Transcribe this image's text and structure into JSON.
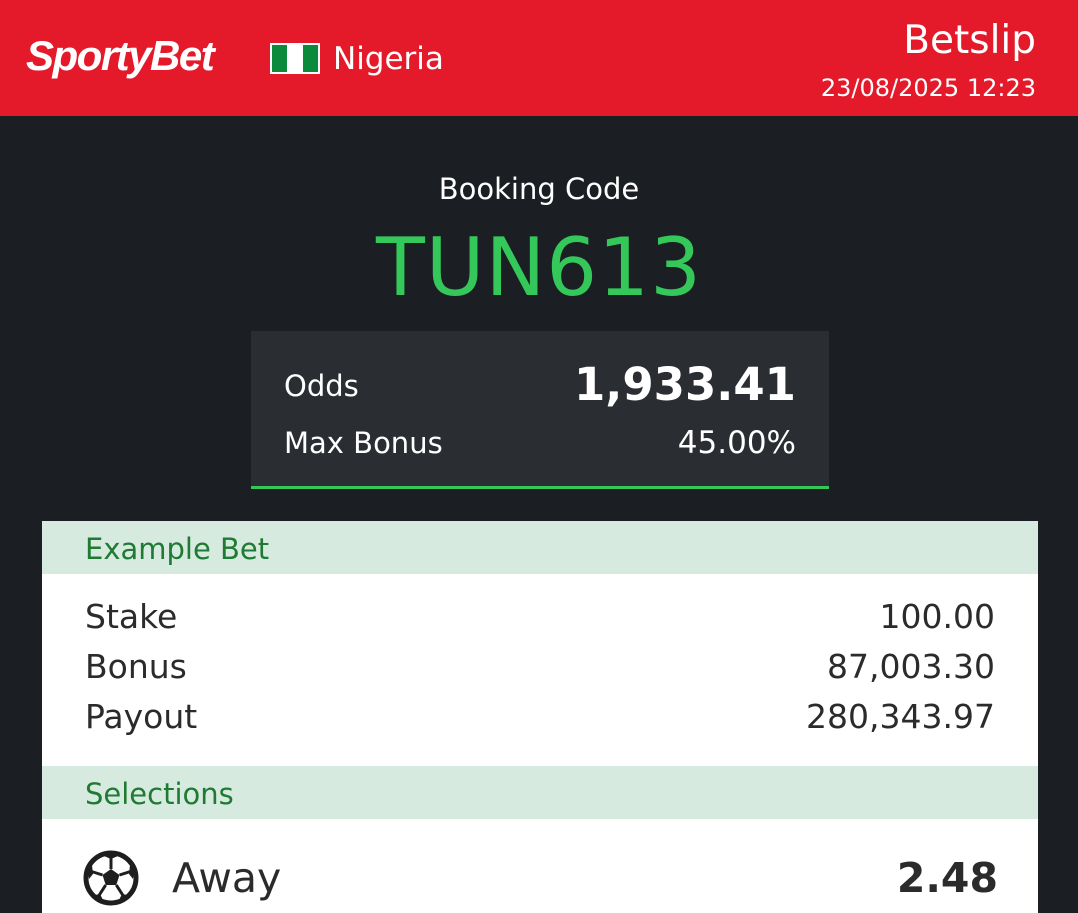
{
  "header": {
    "brand": "SportyBet",
    "country": "Nigeria",
    "title": "Betslip",
    "datetime": "23/08/2025 12:23",
    "colors": {
      "brand_red": "#e41a2b",
      "flag_green": "#0a8a3a"
    }
  },
  "booking": {
    "label": "Booking Code",
    "code": "TUN613",
    "code_color": "#34c759"
  },
  "odds_box": {
    "odds_label": "Odds",
    "odds_value": "1,933.41",
    "bonus_label": "Max Bonus",
    "bonus_value": "45.00%"
  },
  "example_bet": {
    "heading": "Example Bet",
    "rows": [
      {
        "label": "Stake",
        "value": "100.00"
      },
      {
        "label": "Bonus",
        "value": "87,003.30"
      },
      {
        "label": "Payout",
        "value": "280,343.97"
      }
    ]
  },
  "selections": {
    "heading": "Selections",
    "items": [
      {
        "icon": "soccer-ball-icon",
        "pick": "Away",
        "odds": "2.48"
      }
    ]
  }
}
